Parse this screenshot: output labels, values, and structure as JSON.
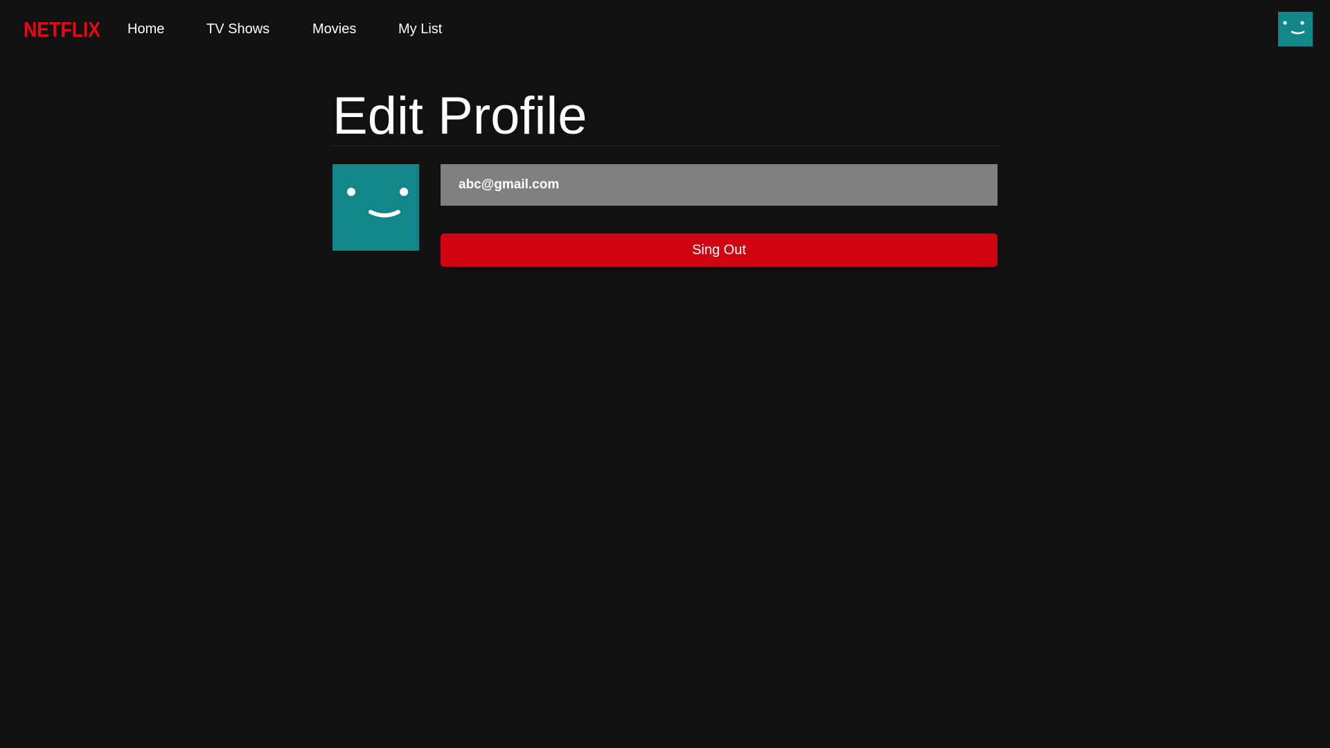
{
  "nav": {
    "logo_text": "NETFLIX",
    "links": [
      "Home",
      "TV Shows",
      "Movies",
      "My List"
    ],
    "avatar_icon": "smiley-avatar-icon"
  },
  "profile": {
    "title": "Edit Profile",
    "avatar_icon": "smiley-avatar-icon",
    "email": "abc@gmail.com",
    "signout_label": "Sing Out"
  },
  "colors": {
    "background": "#111111",
    "brand_red": "#e50914",
    "button_red": "#d10412",
    "avatar_teal": "#12878a",
    "input_gray": "#808080"
  }
}
